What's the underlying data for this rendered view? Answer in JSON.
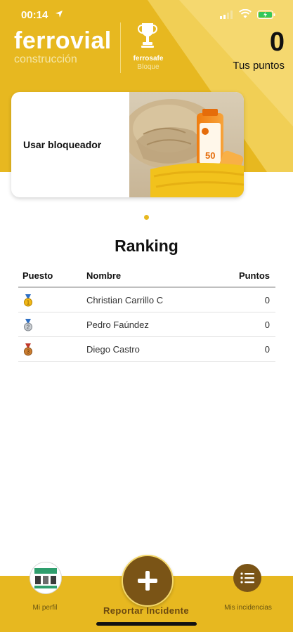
{
  "status_bar": {
    "time": "00:14",
    "location_icon": "location-arrow-icon",
    "signal_icon": "cellular-signal-icon",
    "wifi_icon": "wifi-icon",
    "battery_icon": "battery-charging-icon"
  },
  "header": {
    "brand_name": "ferrovial",
    "brand_sub": "construcción",
    "program_name": "ferrosafe",
    "program_sub": "Bloque",
    "points_value": "0",
    "points_label": "Tus puntos",
    "background_color": "#e7b820"
  },
  "carousel": {
    "card_title": "Usar bloqueador",
    "sunscreen_label": "50",
    "active_index": 0
  },
  "ranking": {
    "title": "Ranking",
    "columns": [
      "Puesto",
      "Nombre",
      "Puntos"
    ],
    "rows": [
      {
        "medal": "gold-medal-icon",
        "name": "Christian Carrillo C",
        "points": "0"
      },
      {
        "medal": "silver-medal-icon",
        "name": "Pedro Faúndez",
        "points": "0"
      },
      {
        "medal": "bronze-medal-icon",
        "name": "Diego Castro",
        "points": "0"
      }
    ]
  },
  "bottom_nav": {
    "profile_label": "Mi perfil",
    "report_label": "Reportar Incidente",
    "incidents_label": "Mis incidencias",
    "accent_color": "#7a5416"
  }
}
